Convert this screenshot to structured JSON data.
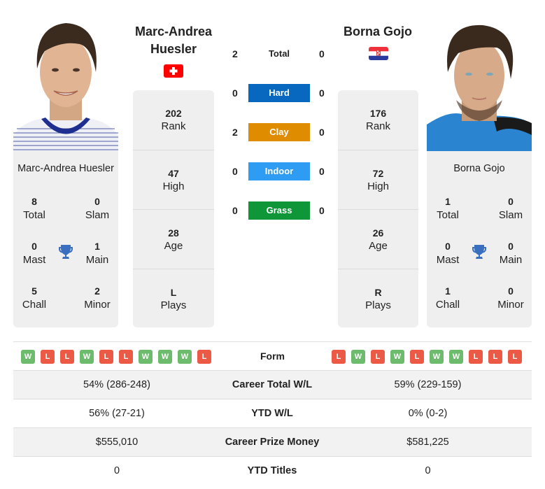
{
  "player_left": {
    "name": "Marc-Andrea Huesler",
    "name_line1": "Marc-Andrea",
    "name_line2": "Huesler",
    "country_flag": "switzerland-flag",
    "photo": "player-photo-huesler",
    "stats": [
      {
        "value": "202",
        "label": "Rank"
      },
      {
        "value": "47",
        "label": "High"
      },
      {
        "value": "28",
        "label": "Age"
      },
      {
        "value": "L",
        "label": "Plays"
      }
    ],
    "titles": {
      "total": {
        "value": "8",
        "label": "Total"
      },
      "slam": {
        "value": "0",
        "label": "Slam"
      },
      "mast": {
        "value": "0",
        "label": "Mast"
      },
      "main": {
        "value": "1",
        "label": "Main"
      },
      "chall": {
        "value": "5",
        "label": "Chall"
      },
      "minor": {
        "value": "2",
        "label": "Minor"
      }
    },
    "form": [
      "W",
      "L",
      "L",
      "W",
      "L",
      "L",
      "W",
      "W",
      "W",
      "L"
    ]
  },
  "player_right": {
    "name": "Borna Gojo",
    "country_flag": "croatia-flag",
    "photo": "player-photo-gojo",
    "stats": [
      {
        "value": "176",
        "label": "Rank"
      },
      {
        "value": "72",
        "label": "High"
      },
      {
        "value": "26",
        "label": "Age"
      },
      {
        "value": "R",
        "label": "Plays"
      }
    ],
    "titles": {
      "total": {
        "value": "1",
        "label": "Total"
      },
      "slam": {
        "value": "0",
        "label": "Slam"
      },
      "mast": {
        "value": "0",
        "label": "Mast"
      },
      "main": {
        "value": "0",
        "label": "Main"
      },
      "chall": {
        "value": "1",
        "label": "Chall"
      },
      "minor": {
        "value": "0",
        "label": "Minor"
      }
    },
    "form": [
      "L",
      "W",
      "L",
      "W",
      "L",
      "W",
      "W",
      "L",
      "L",
      "L"
    ]
  },
  "head_to_head": [
    {
      "label": "Total",
      "left": "2",
      "right": "0",
      "color": null
    },
    {
      "label": "Hard",
      "left": "0",
      "right": "0",
      "color": "#0868c0"
    },
    {
      "label": "Clay",
      "left": "2",
      "right": "0",
      "color": "#df8c00"
    },
    {
      "label": "Indoor",
      "left": "0",
      "right": "0",
      "color": "#2e9cf2"
    },
    {
      "label": "Grass",
      "left": "0",
      "right": "0",
      "color": "#0f9638"
    }
  ],
  "form_label": "Form",
  "comparison": [
    {
      "label": "Career Total W/L",
      "left": "54% (286-248)",
      "right": "59% (229-159)"
    },
    {
      "label": "YTD W/L",
      "left": "56% (27-21)",
      "right": "0% (0-2)"
    },
    {
      "label": "Career Prize Money",
      "left": "$555,010",
      "right": "$581,225"
    },
    {
      "label": "YTD Titles",
      "left": "0",
      "right": "0"
    }
  ],
  "colors": {
    "win": "#6dbb6d",
    "loss": "#ec5a46",
    "trophy": "#3a6fbf",
    "card_bg": "#efefef"
  }
}
